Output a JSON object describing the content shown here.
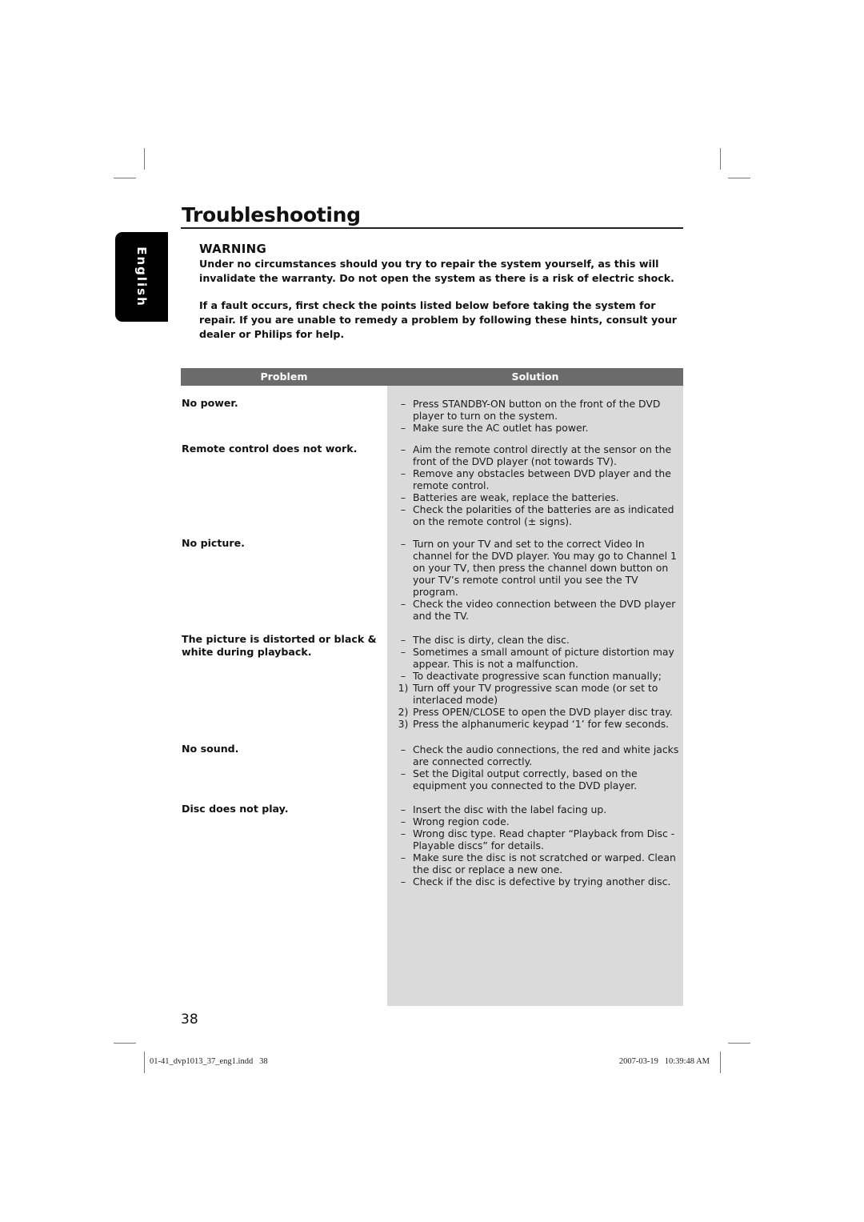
{
  "page": {
    "title": "Troubleshooting",
    "language_tab": "English",
    "page_number": "38"
  },
  "warning": {
    "heading": "WARNING",
    "text": "Under no circumstances should you try to repair the system yourself, as this will invalidate the warranty. Do not open the system as there is a risk of electric shock.",
    "intro": "If a fault occurs, first check the points listed below before taking the system for repair. If you are unable to remedy a problem by following these hints, consult your dealer or Philips for help."
  },
  "table": {
    "header_problem": "Problem",
    "header_solution": "Solution",
    "colors": {
      "header_bg": "#6b6b6b",
      "solution_bg": "#dadada"
    },
    "rows": [
      {
        "problem": "No power.",
        "solutions": [
          {
            "marker": "–",
            "text": "Press STANDBY-ON button on the front of the DVD player to turn on the system."
          },
          {
            "marker": "–",
            "text": "Make sure the AC outlet has power."
          }
        ]
      },
      {
        "problem": "Remote control does not work.",
        "solutions": [
          {
            "marker": "–",
            "text": "Aim the remote control directly at the sensor on the front of the DVD player (not towards TV)."
          },
          {
            "marker": "–",
            "text": "Remove any obstacles between DVD player and the remote control."
          },
          {
            "marker": "–",
            "text": "Batteries are weak, replace the batteries."
          },
          {
            "marker": "–",
            "text": "Check the polarities of the batteries are as indicated on the remote control (± signs)."
          }
        ]
      },
      {
        "problem": "No picture.",
        "solutions": [
          {
            "marker": "–",
            "text": "Turn on your TV and set to the correct Video In channel for the DVD player. You may go to Channel 1 on your TV, then press the channel down button on your TV’s remote control until you see the TV program."
          },
          {
            "marker": "–",
            "text": "Check the video connection between the DVD player and the TV."
          }
        ]
      },
      {
        "problem": "The picture is distorted or black & white during playback.",
        "solutions": [
          {
            "marker": "–",
            "text": "The disc is dirty, clean the disc."
          },
          {
            "marker": "–",
            "text": "Sometimes a small amount of picture distortion may appear. This is not a malfunction."
          },
          {
            "marker": "–",
            "text": "To deactivate progressive scan function manually;"
          },
          {
            "marker": "1)",
            "text": "Turn off your TV progressive scan mode (or set to interlaced mode)"
          },
          {
            "marker": "2)",
            "text": "Press OPEN/CLOSE to open the DVD player disc tray."
          },
          {
            "marker": "3)",
            "text": "Press the alphanumeric keypad ‘1’ for few seconds."
          }
        ]
      },
      {
        "problem": "No sound.",
        "solutions": [
          {
            "marker": "–",
            "text": "Check the audio connections, the red and white jacks are connected correctly."
          },
          {
            "marker": "–",
            "text": "Set the Digital output correctly, based on the equipment you connected to the DVD player."
          }
        ]
      },
      {
        "problem": "Disc does not play.",
        "solutions": [
          {
            "marker": "–",
            "text": "Insert the disc with the label facing up."
          },
          {
            "marker": "–",
            "text": "Wrong region code."
          },
          {
            "marker": "–",
            "text": "Wrong disc type. Read chapter “Playback from Disc - Playable discs” for details."
          },
          {
            "marker": "–",
            "text": "Make sure the disc is not scratched or warped. Clean the disc or replace a new one."
          },
          {
            "marker": "–",
            "text": "Check if the disc is defective by trying another disc."
          }
        ]
      }
    ]
  },
  "footer": {
    "file": "01-41_dvp1013_37_eng1.indd   38",
    "timestamp": "2007-03-19   10:39:48 AM"
  }
}
